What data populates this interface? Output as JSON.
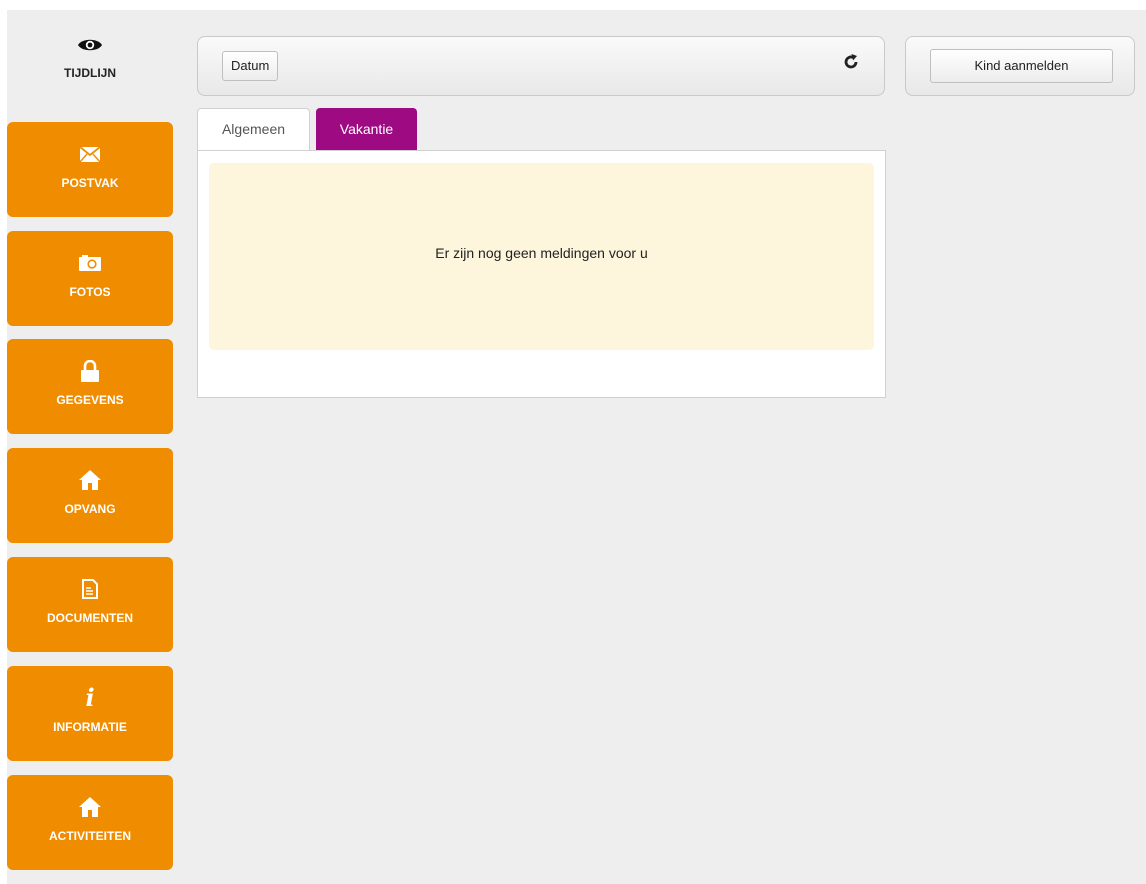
{
  "sidebar": {
    "active": {
      "label": "TIJDLIJN",
      "icon": "eye-icon"
    },
    "items": [
      {
        "label": "POSTVAK",
        "icon": "envelope-icon"
      },
      {
        "label": "FOTOS",
        "icon": "camera-icon"
      },
      {
        "label": "GEGEVENS",
        "icon": "lock-icon"
      },
      {
        "label": "OPVANG",
        "icon": "home-icon"
      },
      {
        "label": "DOCUMENTEN",
        "icon": "document-icon"
      },
      {
        "label": "INFORMATIE",
        "icon": "info-icon"
      },
      {
        "label": "ACTIVITEITEN",
        "icon": "home-icon"
      }
    ]
  },
  "toolbar": {
    "date_button": "Datum",
    "refresh_icon": "refresh-icon",
    "register_child_button": "Kind aanmelden"
  },
  "tabs": [
    {
      "label": "Algemeen",
      "active": false
    },
    {
      "label": "Vakantie",
      "active": true
    }
  ],
  "panel": {
    "message": "Er zijn nog geen meldingen voor u"
  },
  "colors": {
    "sidebar_orange": "#f08c00",
    "active_tab_purple": "#9e0a82",
    "alert_background": "#fdf5dc",
    "page_background": "#eeeeee"
  }
}
